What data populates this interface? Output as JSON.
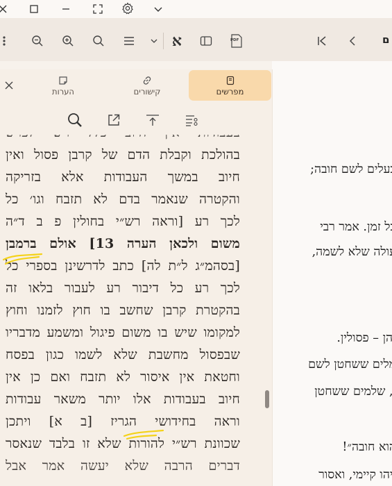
{
  "colors": {
    "accent": "#f9d9ab",
    "panel_bg": "#f6efe7",
    "toolbar_bg": "#f0e9e2",
    "highlight": "#f4d21a"
  },
  "titlebar": {
    "icons": [
      "close-icon",
      "maximize-icon",
      "minimize-icon",
      "fullscreen-icon",
      "gear-icon",
      "chevron-down-icon"
    ]
  },
  "toolbar": {
    "font_button_label": "א",
    "pdf_label": "PDF",
    "edge_label": "ם"
  },
  "panel": {
    "tabs": [
      {
        "label": "מפרשים",
        "icon": "book-icon",
        "active": true
      },
      {
        "label": "קישורים",
        "icon": "link-icon",
        "active": false
      },
      {
        "label": "הערות",
        "icon": "note-icon",
        "active": false
      }
    ],
    "tools": [
      "search-icon",
      "open-external-icon",
      "align-top-icon",
      "list-settings-icon"
    ],
    "lines": [
      "בהולכת וקבלת הדם של קרבן פסול ואין",
      "חיוב במשך העבודות אלא בזריקה",
      "והקטרה שנאמר בדם לא תזבח וגו׳ כל",
      "לכך רע [וראה רש״י בחולין פ ב ד״ה",
      "משום ולכאן הערה 13] אולם ברמבן",
      "[בסהמ״ג ל״ת לה] כתב לדרשינן בספרי כל",
      "לכך רע כל דיבור רע לעבור בלאו זה",
      "בהקטרת קרבן שחשב בו חוץ לזמנו וחוץ",
      "למקומו שיש בו משום פיגול ומשמע מדבריו",
      "שבפסול מחשבת שלא לשמו כגון בפסח",
      "וחטאת אין איסור לא תזבח ואם כן אין",
      "חיוב בעבודות אלו יותר משאר עבודות",
      "וראה בחידושי הגריז [ב א] ויתכן",
      "שכוונת רש״י להורות שלא זו בלבד שנאסר"
    ]
  },
  "main": {
    "lines": [
      "בעלים לשם חובה;",
      "כל זמן. אמר רבי",
      "עולה שלא לשמה,",
      "זהן – פסולין.",
      "מלים ששחטן לשם",
      "ן, שלמים ששחטן",
      "הוא חובה״!",
      "ויהו קיימי, ואסור"
    ]
  }
}
